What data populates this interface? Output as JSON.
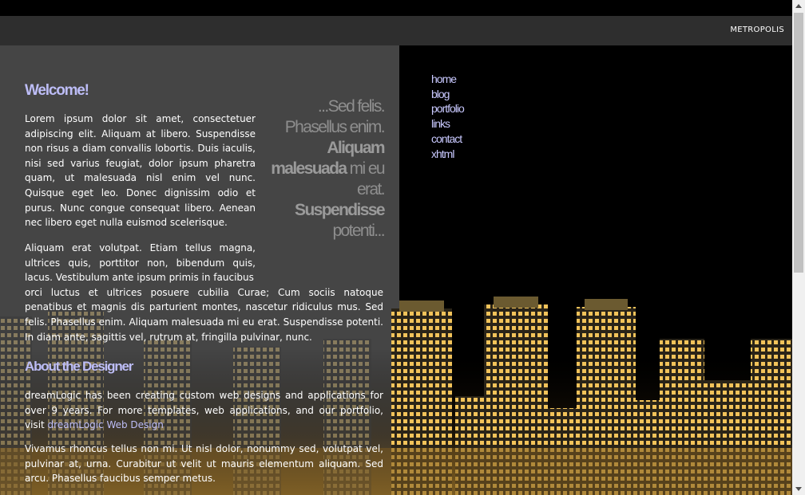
{
  "header": {
    "brand": "METROPOLIS"
  },
  "welcome": {
    "title": "Welcome!",
    "quote": {
      "l1": "...Sed felis.",
      "l2": "Phasellus enim.",
      "l3_bold": "Aliquam",
      "l4_bold": "malesuada",
      "l4_rest": " mi eu",
      "l5": "erat.",
      "l6_bold": "Suspendisse",
      "l7": "potenti..."
    },
    "para1": "Lorem ipsum dolor sit amet, consectetuer adipiscing elit. Aliquam at libero. Suspendisse non risus a diam convallis lobortis. Duis iaculis, nisi sed varius feugiat, dolor ipsum pharetra quam, ut malesuada nisl enim vel nunc. Quisque eget leo. Donec dignissim odio et purus. Nunc congue consequat libero. Aenean nec libero eget nulla euismod scelerisque.",
    "para2_a": "Aliquam erat volutpat. Etiam tellus magna, ultrices quis, porttitor non, bibendum quis, lacus. Vestibulum ante ipsum primis in faucibus",
    "para2_b": "orci luctus et ultrices posuere cubilia Curae; Cum sociis natoque penatibus et magnis dis parturient montes, nascetur ridiculus mus. Sed felis. Phasellus enim. Aliquam malesuada mi eu erat. Suspendisse potenti. In diam ante, sagittis vel, rutrum at, fringilla pulvinar, nunc."
  },
  "about": {
    "title": "About the Designer",
    "para1_text": "dreamLogic has been creating custom web designs and applications for over 9 years. For more templates, web applications, and our portfolio, visit ",
    "para1_link": "dreamLogic Web Design",
    "para2": "Vivamus rhoncus tellus non mi. Ut nisl dolor, nonummy sed, volutpat vel, pulvinar at, urna. Curabitur ut velit ut mauris elementum aliquam. Sed arcu. Phasellus faucibus semper metus."
  },
  "nav": {
    "home": "home",
    "blog": "blog",
    "portfolio": "portfolio",
    "links": "links",
    "contact": "contact",
    "xhtml": "xhtml"
  },
  "colors": {
    "accent": "#bdbdf7",
    "nav_link": "#c9c9ff",
    "panel": "#454545",
    "header": "#2e2e2e"
  }
}
